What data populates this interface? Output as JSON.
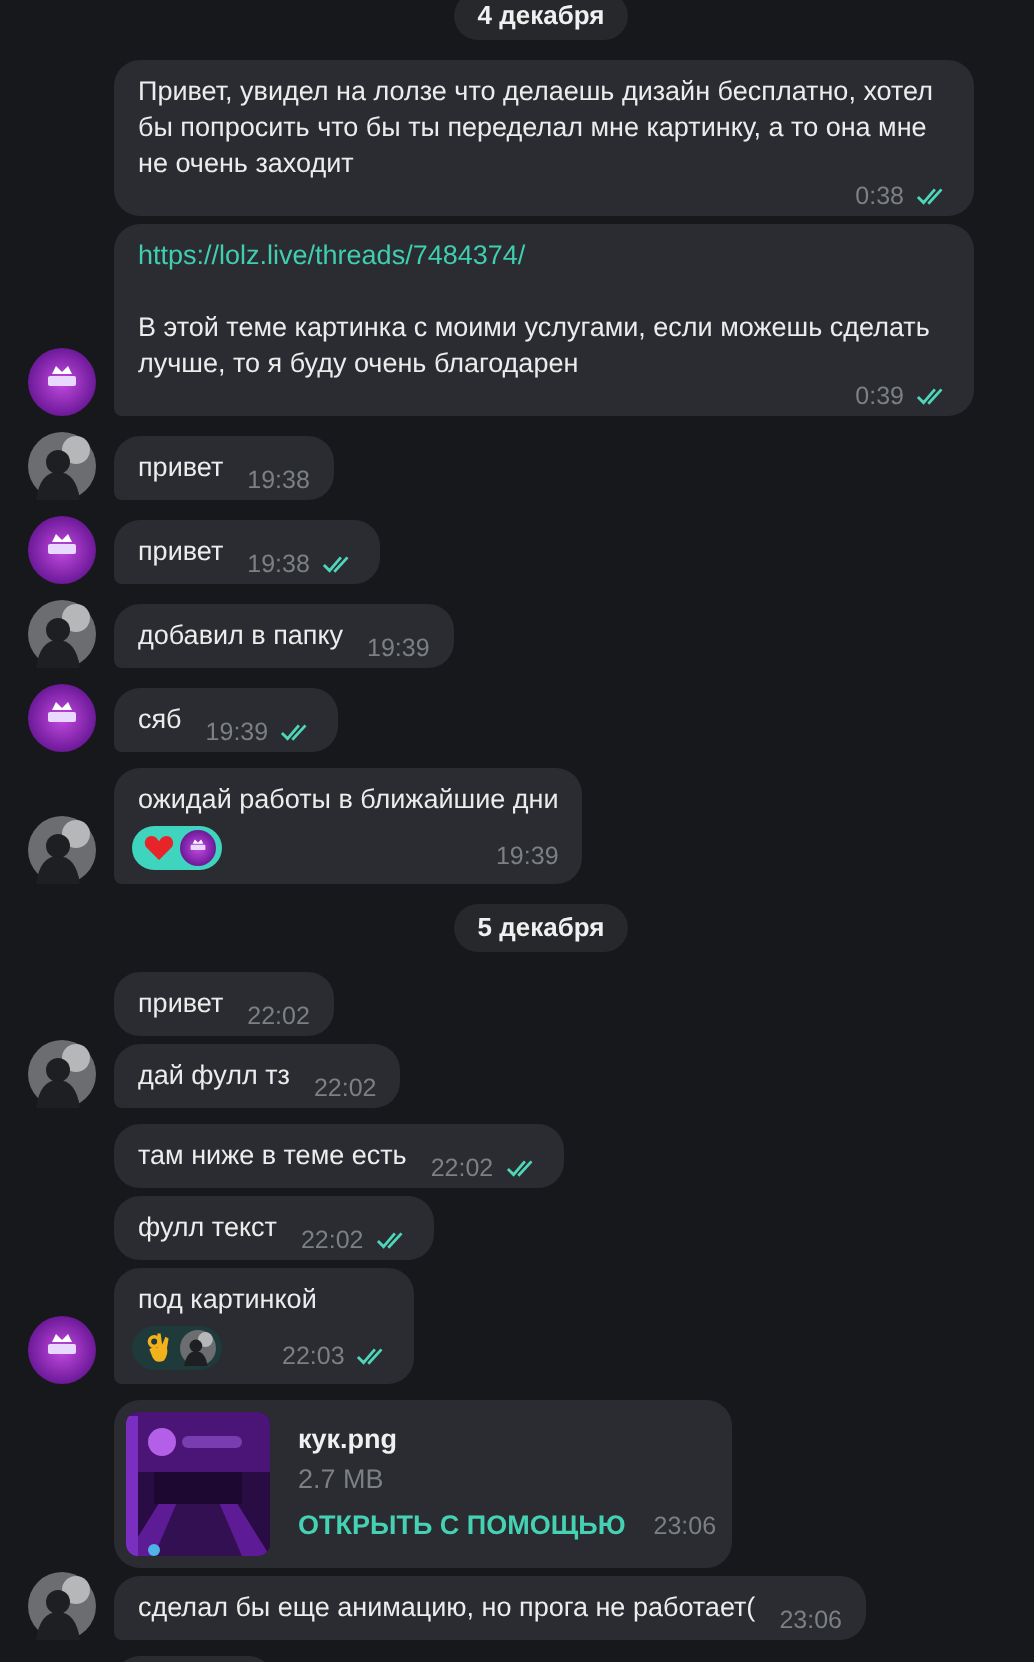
{
  "chat": [
    {
      "kind": "date",
      "text": "4 декабря"
    },
    {
      "kind": "group",
      "outgoing": true,
      "messages": [
        {
          "kind": "text",
          "text": "Привет, увидел на лолзе что делаешь дизайн бесплатно, хотел бы попросить что бы ты переделал мне картинку, а то она мне не очень заходит",
          "time": "0:38",
          "read": true
        },
        {
          "kind": "link_text",
          "link": "https://lolz.live/threads/7484374/",
          "text": "В этой теме картинка с моими услугами, если можешь сделать лучше, то я буду очень благодарен",
          "time": "0:39",
          "read": true
        }
      ]
    },
    {
      "kind": "group",
      "outgoing": false,
      "messages": [
        {
          "kind": "text",
          "text": "привет",
          "time": "19:38",
          "read": false
        }
      ]
    },
    {
      "kind": "group",
      "outgoing": true,
      "messages": [
        {
          "kind": "text",
          "text": "привет",
          "time": "19:38",
          "read": true
        }
      ]
    },
    {
      "kind": "group",
      "outgoing": false,
      "messages": [
        {
          "kind": "text",
          "text": "добавил в папку",
          "time": "19:39",
          "read": false
        }
      ]
    },
    {
      "kind": "group",
      "outgoing": true,
      "messages": [
        {
          "kind": "text",
          "text": "сяб",
          "time": "19:39",
          "read": true
        }
      ]
    },
    {
      "kind": "group",
      "outgoing": false,
      "messages": [
        {
          "kind": "text",
          "text": "ожидай работы в ближайшие дни",
          "time": "19:39",
          "read": false,
          "reactions": [
            {
              "kind": "heart",
              "by_me": true,
              "selected": true
            }
          ]
        }
      ]
    },
    {
      "kind": "date",
      "text": "5 декабря"
    },
    {
      "kind": "group",
      "outgoing": false,
      "messages": [
        {
          "kind": "text",
          "text": "привет",
          "time": "22:02",
          "read": false
        },
        {
          "kind": "text",
          "text": "дай фулл тз",
          "time": "22:02",
          "read": false
        }
      ]
    },
    {
      "kind": "group",
      "outgoing": true,
      "messages": [
        {
          "kind": "text",
          "text": "там ниже в теме есть",
          "time": "22:02",
          "read": true
        },
        {
          "kind": "text",
          "text": "фулл текст",
          "time": "22:02",
          "read": true
        },
        {
          "kind": "text",
          "text": "под картинкой",
          "time": "22:03",
          "read": true,
          "reactions": [
            {
              "kind": "ok_hand",
              "by_me": false,
              "selected": false
            }
          ]
        }
      ]
    },
    {
      "kind": "group",
      "outgoing": false,
      "messages": [
        {
          "kind": "file",
          "name": "кук.png",
          "size": "2.7 MB",
          "action": "ОТКРЫТЬ С ПОМОЩЬЮ",
          "time": "23:06",
          "read": false
        },
        {
          "kind": "text",
          "text": "сделал бы еще анимацию, но прога не работает(",
          "time": "23:06",
          "read": false
        }
      ]
    },
    {
      "kind": "partial"
    }
  ]
}
